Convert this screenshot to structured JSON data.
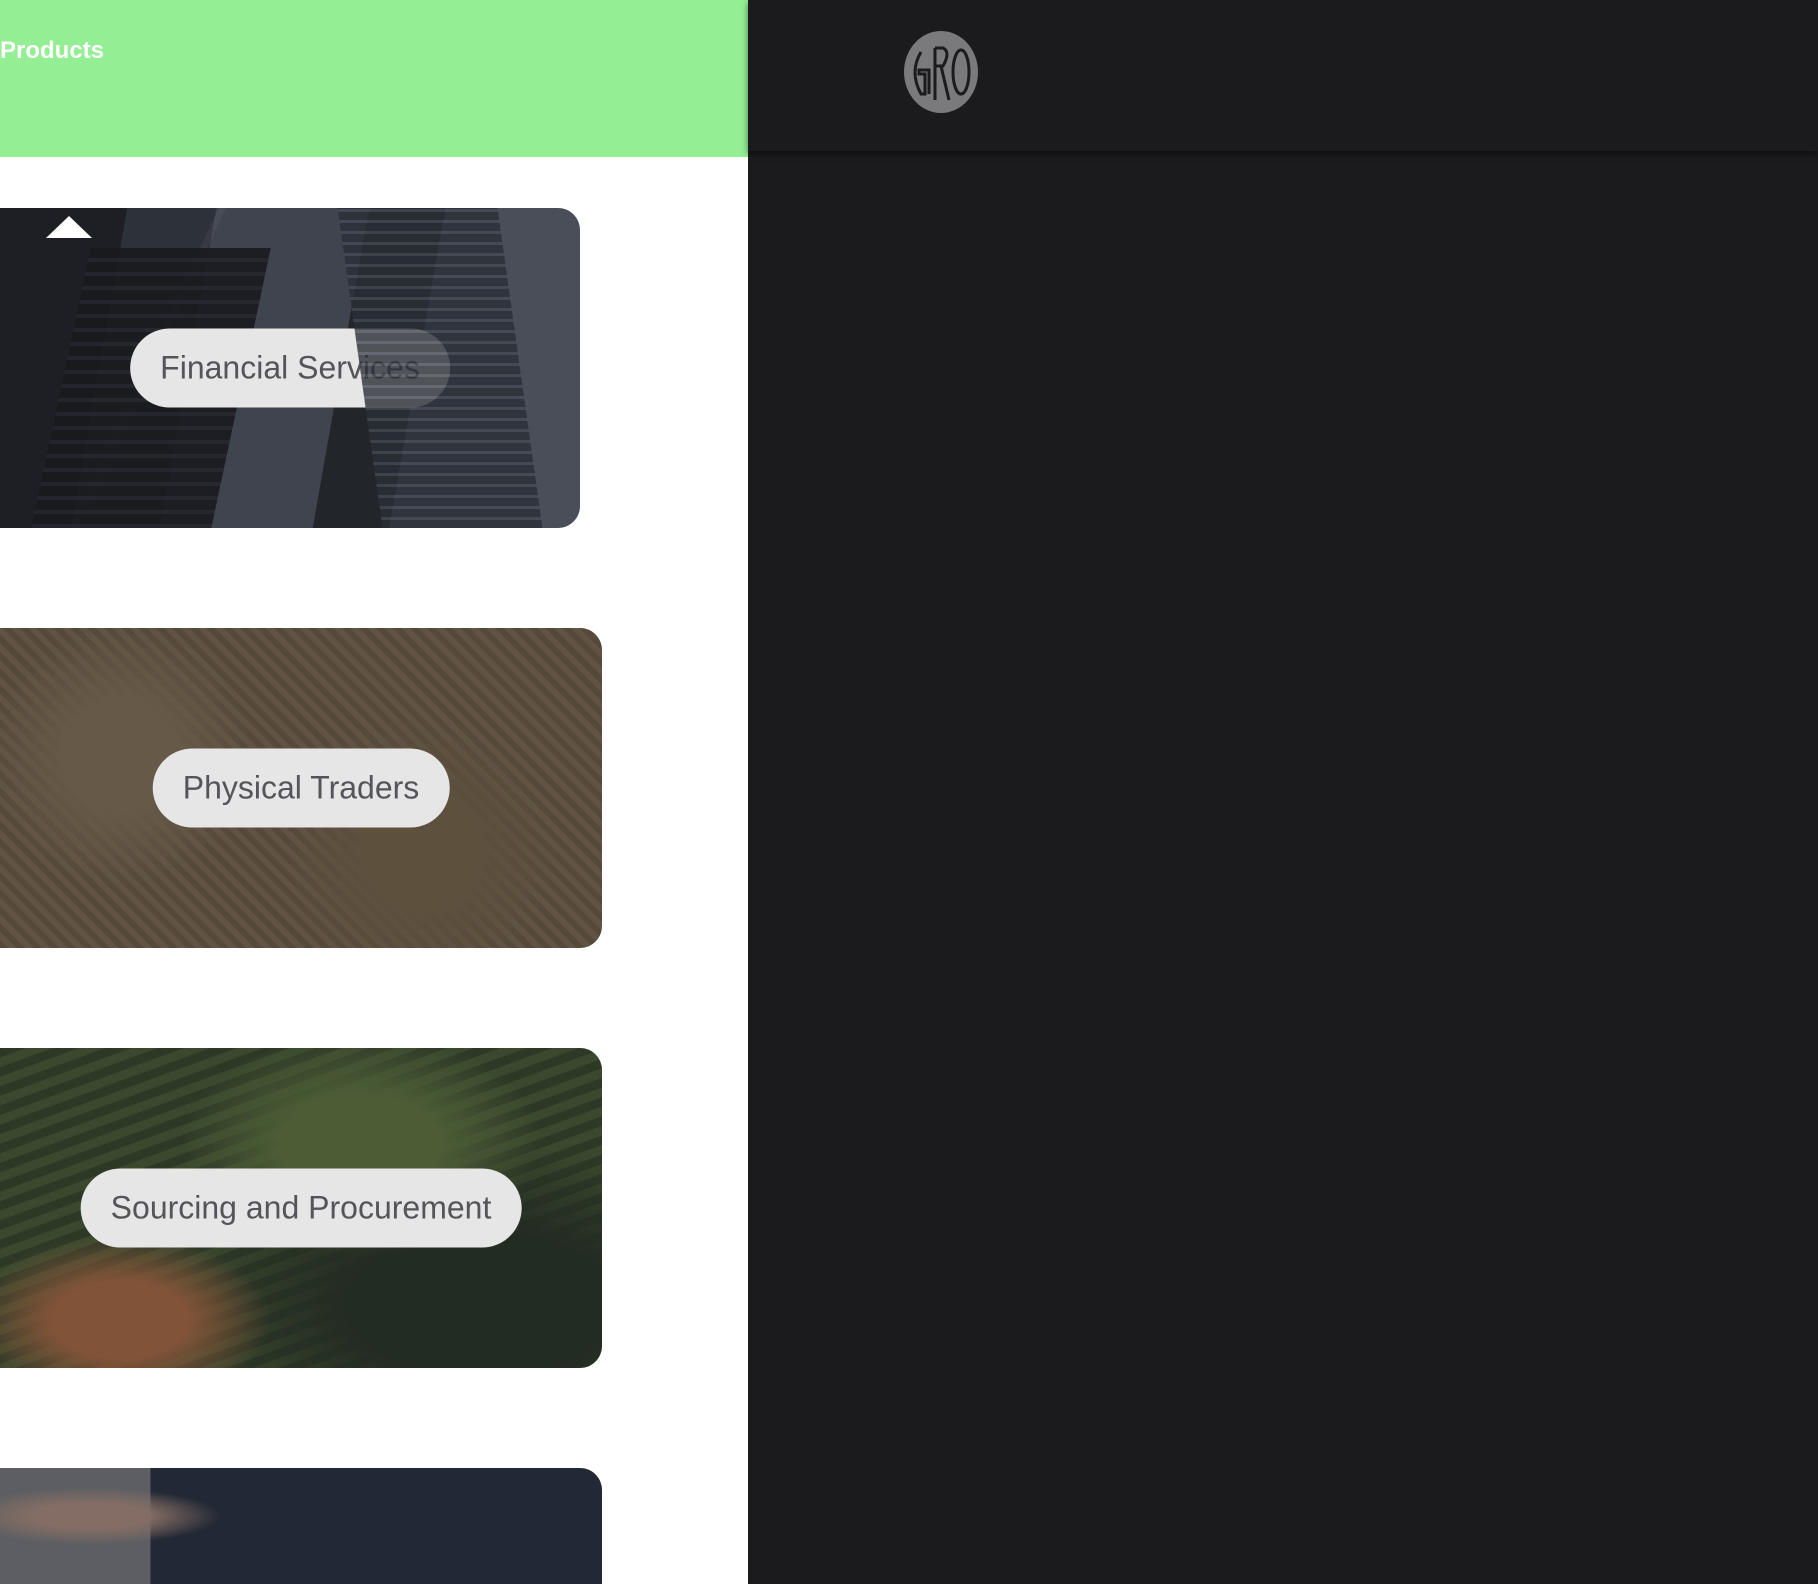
{
  "menu": {
    "title": "Products",
    "cards": [
      {
        "label": "Financial Services"
      },
      {
        "label": "Physical Traders"
      },
      {
        "label": "Sourcing and Procurement"
      },
      {
        "label": ""
      }
    ]
  },
  "logo": {
    "text": "GRO"
  },
  "colors": {
    "header_green": "#94ee94",
    "background_dark": "#1b1b1d",
    "pill_bg": "#e6e6e7"
  }
}
